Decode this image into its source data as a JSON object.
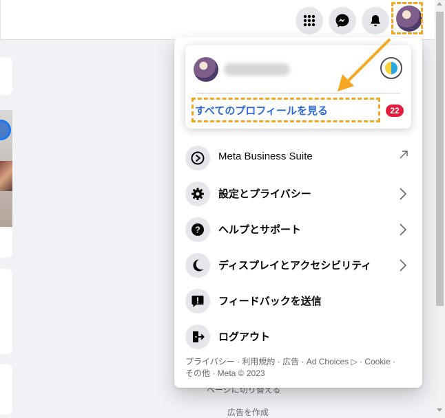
{
  "topbar": {
    "menu_icon": "grid-menu-icon",
    "messenger_icon": "messenger-icon",
    "notifications_icon": "bell-icon",
    "account_icon": "avatar"
  },
  "behind_items": {
    "switch_page": "ページに切り替える",
    "create_ad": "広告を作成"
  },
  "account_menu": {
    "profile": {
      "see_all_profiles": "すべてのプロフィールを見る",
      "badge_count": "22"
    },
    "items": [
      {
        "label": "Meta Business Suite",
        "icon": "meta-business-suite-icon",
        "trailing": "external-link-icon"
      },
      {
        "label": "設定とプライバシー",
        "icon": "gear-icon",
        "trailing": "chevron-right-icon"
      },
      {
        "label": "ヘルプとサポート",
        "icon": "question-icon",
        "trailing": "chevron-right-icon"
      },
      {
        "label": "ディスプレイとアクセシビリティ",
        "icon": "moon-icon",
        "trailing": "chevron-right-icon"
      },
      {
        "label": "フィードバックを送信",
        "icon": "feedback-icon",
        "trailing": ""
      },
      {
        "label": "ログアウト",
        "icon": "logout-icon",
        "trailing": ""
      }
    ],
    "footer": {
      "line1": "プライバシー · 利用規約 · 広告 · Ad Choices ▷ · Cookie ·",
      "line2": "その他 · Meta © 2023"
    }
  },
  "colors": {
    "accent_link": "#2d6ad8",
    "badge": "#e41e3f",
    "highlight": "#f5a623",
    "icon_bg": "#e4e6eb"
  }
}
